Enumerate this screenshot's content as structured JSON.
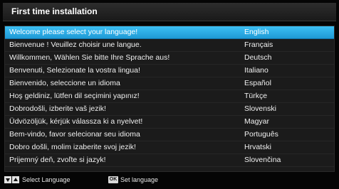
{
  "header": {
    "title": "First time installation"
  },
  "languages": [
    {
      "phrase": "Welcome please select your language!",
      "lang": "English",
      "selected": true
    },
    {
      "phrase": "Bienvenue ! Veuillez choisir une langue.",
      "lang": "Français"
    },
    {
      "phrase": "Willkommen, Wählen Sie bitte Ihre Sprache aus!",
      "lang": "Deutsch"
    },
    {
      "phrase": "Benvenuti, Selezionate la vostra lingua!",
      "lang": "Italiano"
    },
    {
      "phrase": "Bienvenido, seleccione un idioma",
      "lang": "Español"
    },
    {
      "phrase": "Hoş geldiniz, lütfen dil seçimini yapınız!",
      "lang": "Türkçe"
    },
    {
      "phrase": "Dobrodošli, izberite vaš jezik!",
      "lang": "Slovenski"
    },
    {
      "phrase": "Üdvözöljük, kérjük válassza ki a nyelvet!",
      "lang": "Magyar"
    },
    {
      "phrase": "Bem-vindo, favor selecionar seu idioma",
      "lang": "Português"
    },
    {
      "phrase": "Dobro došli, molim izaberite svoj jezik!",
      "lang": "Hrvatski"
    },
    {
      "phrase": "Prijemný deň, zvoľte si jazyk!",
      "lang": "Slovenčina"
    }
  ],
  "footer": {
    "nav_label": "Select Language",
    "ok_key": "OK",
    "ok_label": "Set language"
  },
  "colors": {
    "selection": "#2fb0ec",
    "background": "#050505"
  }
}
